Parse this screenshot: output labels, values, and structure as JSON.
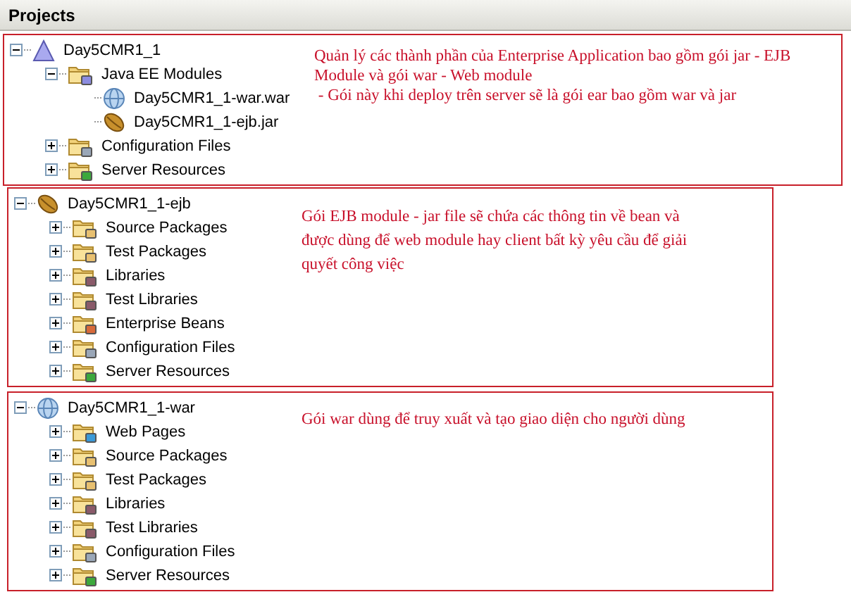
{
  "panel": {
    "title": "Projects"
  },
  "sections": [
    {
      "root": {
        "label": "Day5CMR1_1",
        "kind": "ear",
        "expanded": true,
        "children": [
          {
            "label": "Java EE Modules",
            "kind": "modules",
            "expanded": true,
            "children": [
              {
                "label": "Day5CMR1_1-war.war",
                "kind": "war"
              },
              {
                "label": "Day5CMR1_1-ejb.jar",
                "kind": "jar"
              }
            ]
          },
          {
            "label": "Configuration Files",
            "kind": "config",
            "expanded": false
          },
          {
            "label": "Server Resources",
            "kind": "server",
            "expanded": false
          }
        ]
      },
      "note": [
        "Quản lý các thành phần của Enterprise Application bao gồm gói jar - EJB",
        "Module và gói war - Web module",
        " - Gói này khi deploy trên server sẽ là gói ear bao gồm war và jar"
      ]
    },
    {
      "root": {
        "label": "Day5CMR1_1-ejb",
        "kind": "jar",
        "expanded": true,
        "children": [
          {
            "label": "Source Packages",
            "kind": "source",
            "expanded": false
          },
          {
            "label": "Test Packages",
            "kind": "source",
            "expanded": false
          },
          {
            "label": "Libraries",
            "kind": "library",
            "expanded": false
          },
          {
            "label": "Test Libraries",
            "kind": "library",
            "expanded": false
          },
          {
            "label": "Enterprise Beans",
            "kind": "beans",
            "expanded": false
          },
          {
            "label": "Configuration Files",
            "kind": "config",
            "expanded": false
          },
          {
            "label": "Server Resources",
            "kind": "server",
            "expanded": false
          }
        ]
      },
      "note": [
        "Gói EJB module - jar file sẽ chứa các thông tin về bean và",
        "được dùng để web module hay client bất kỳ yêu cầu để giải",
        "quyết công việc"
      ]
    },
    {
      "root": {
        "label": "Day5CMR1_1-war",
        "kind": "war",
        "expanded": true,
        "children": [
          {
            "label": "Web Pages",
            "kind": "web",
            "expanded": false
          },
          {
            "label": "Source Packages",
            "kind": "source",
            "expanded": false
          },
          {
            "label": "Test Packages",
            "kind": "source",
            "expanded": false
          },
          {
            "label": "Libraries",
            "kind": "library",
            "expanded": false
          },
          {
            "label": "Test Libraries",
            "kind": "library",
            "expanded": false
          },
          {
            "label": "Configuration Files",
            "kind": "config",
            "expanded": false
          },
          {
            "label": "Server Resources",
            "kind": "server",
            "expanded": false
          }
        ]
      },
      "note": [
        "Gói war dùng để truy xuất và tạo giao diện cho người dùng"
      ]
    }
  ]
}
